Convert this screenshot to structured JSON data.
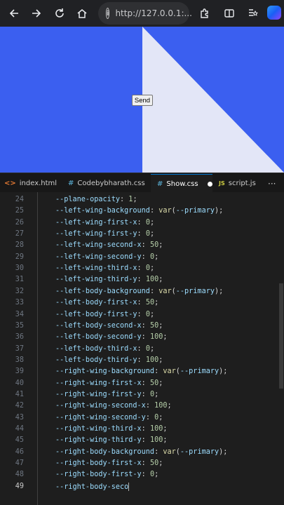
{
  "browser": {
    "url": "http://127.0.0.1:...",
    "icons": [
      "back-icon",
      "forward-icon",
      "reload-icon",
      "home-icon",
      "info-icon",
      "extensions-icon",
      "split-screen-icon",
      "favorites-icon",
      "copilot-icon"
    ]
  },
  "preview": {
    "background": "#3b5ff0",
    "triangle_color": "#e3e6f7",
    "button_label": "Send"
  },
  "tabs": [
    {
      "icon": "<>",
      "label": "index.html",
      "icon_color": "#e37933",
      "modified": true
    },
    {
      "icon": "#",
      "label": "Codebybharath.css",
      "icon_color": "#519aba",
      "modified": false
    },
    {
      "icon": "#",
      "label": "Show.css",
      "icon_color": "#519aba",
      "modified": true,
      "active": true
    },
    {
      "icon": "JS",
      "label": "script.js",
      "icon_color": "#cbcb41",
      "modified": false
    }
  ],
  "more": "···",
  "lines": [
    {
      "n": 24,
      "prop": "--plane-opacity",
      "value": "1",
      "kind": "num"
    },
    {
      "n": 25,
      "prop": "--left-wing-background",
      "value": "--primary",
      "kind": "var"
    },
    {
      "n": 26,
      "prop": "--left-wing-first-x",
      "value": "0",
      "kind": "num"
    },
    {
      "n": 27,
      "prop": "--left-wing-first-y",
      "value": "0",
      "kind": "num"
    },
    {
      "n": 28,
      "prop": "--left-wing-second-x",
      "value": "50",
      "kind": "num"
    },
    {
      "n": 29,
      "prop": "--left-wing-second-y",
      "value": "0",
      "kind": "num"
    },
    {
      "n": 30,
      "prop": "--left-wing-third-x",
      "value": "0",
      "kind": "num"
    },
    {
      "n": 31,
      "prop": "--left-wing-third-y",
      "value": "100",
      "kind": "num"
    },
    {
      "n": 32,
      "prop": "--left-body-background",
      "value": "--primary",
      "kind": "var"
    },
    {
      "n": 33,
      "prop": "--left-body-first-x",
      "value": "50",
      "kind": "num"
    },
    {
      "n": 34,
      "prop": "--left-body-first-y",
      "value": "0",
      "kind": "num"
    },
    {
      "n": 35,
      "prop": "--left-body-second-x",
      "value": "50",
      "kind": "num"
    },
    {
      "n": 36,
      "prop": "--left-body-second-y",
      "value": "100",
      "kind": "num"
    },
    {
      "n": 37,
      "prop": "--left-body-third-x",
      "value": "0",
      "kind": "num"
    },
    {
      "n": 38,
      "prop": "--left-body-third-y",
      "value": "100",
      "kind": "num"
    },
    {
      "n": 39,
      "prop": "--right-wing-background",
      "value": "--primary",
      "kind": "var"
    },
    {
      "n": 40,
      "prop": "--right-wing-first-x",
      "value": "50",
      "kind": "num"
    },
    {
      "n": 41,
      "prop": "--right-wing-first-y",
      "value": "0",
      "kind": "num"
    },
    {
      "n": 42,
      "prop": "--right-wing-second-x",
      "value": "100",
      "kind": "num"
    },
    {
      "n": 43,
      "prop": "--right-wing-second-y",
      "value": "0",
      "kind": "num"
    },
    {
      "n": 44,
      "prop": "--right-wing-third-x",
      "value": "100",
      "kind": "num"
    },
    {
      "n": 45,
      "prop": "--right-wing-third-y",
      "value": "100",
      "kind": "num"
    },
    {
      "n": 46,
      "prop": "--right-body-background",
      "value": "--primary",
      "kind": "var"
    },
    {
      "n": 47,
      "prop": "--right-body-first-x",
      "value": "50",
      "kind": "num"
    },
    {
      "n": 48,
      "prop": "--right-body-first-y",
      "value": "0",
      "kind": "num"
    },
    {
      "n": 49,
      "prop": "--right-body-seco",
      "value": "",
      "kind": "partial",
      "current": true
    }
  ]
}
